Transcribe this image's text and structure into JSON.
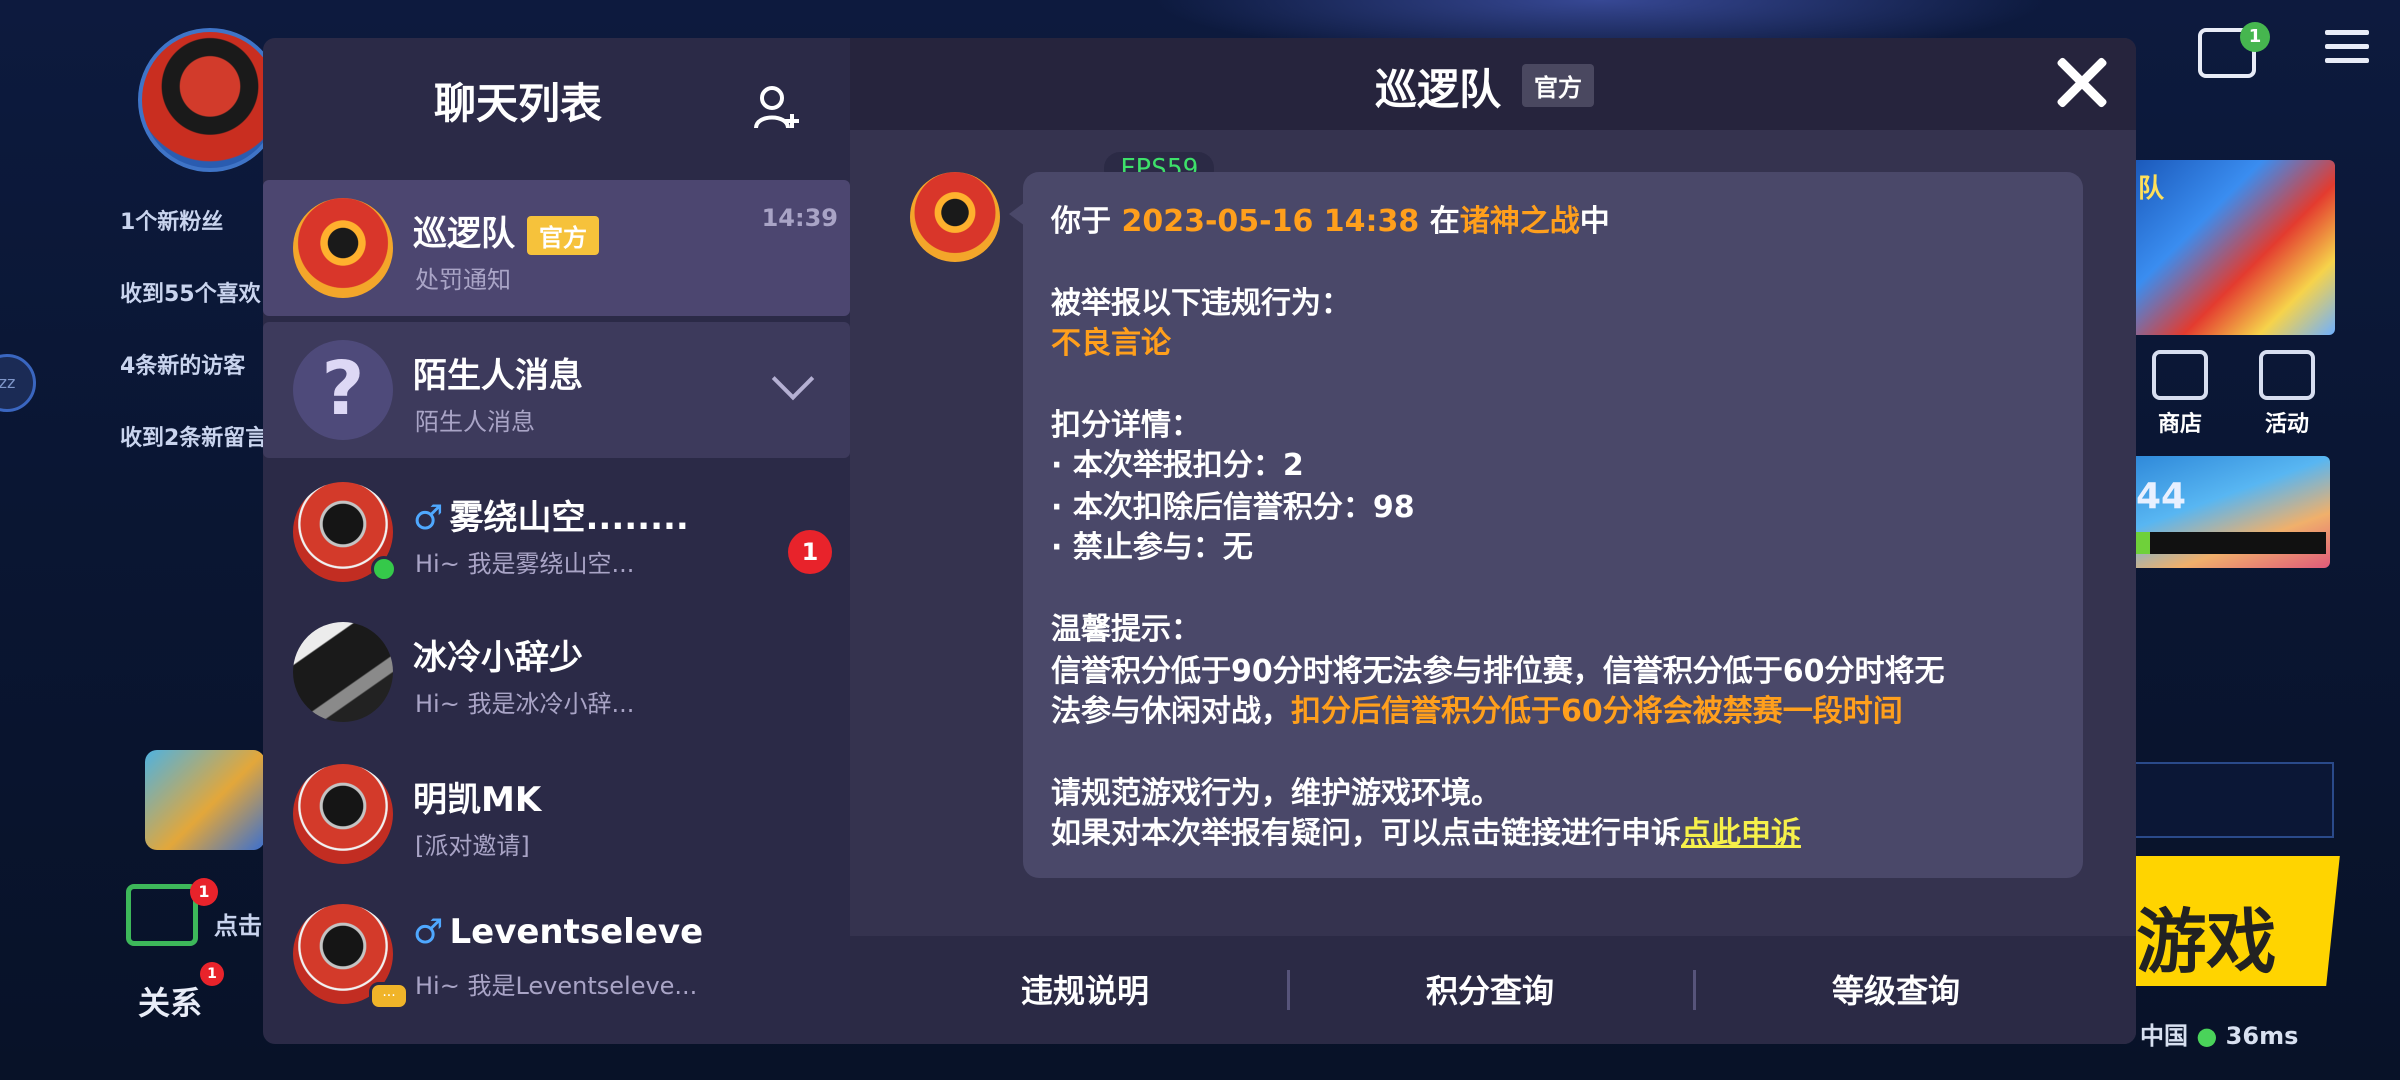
{
  "background": {
    "notifications": [
      "1个新粉丝",
      "收到55个喜欢",
      "4条新的访客",
      "收到2条新留言"
    ],
    "side_label": "zz",
    "tv_badge": "1",
    "tile_number": "44",
    "shop_label": "商店",
    "activity_label": "活动",
    "play_label": "游戏",
    "region": "中国",
    "ping": "36ms",
    "relation_label": "关系",
    "relation_badge": "1",
    "chat_badge": "1",
    "tap_hint": "点击"
  },
  "sidebar": {
    "title": "聊天列表",
    "items": [
      {
        "name": "巡逻队",
        "tag": "官方",
        "subtitle": "处罚通知",
        "time": "14:39"
      },
      {
        "name": "陌生人消息",
        "subtitle": "陌生人消息",
        "avatar_glyph": "?"
      },
      {
        "gender": "♂",
        "name": "雾绕山空........",
        "subtitle": "Hi~ 我是雾绕山空...",
        "unread": "1"
      },
      {
        "name": "冰冷小辞少",
        "subtitle": "Hi~ 我是冰冷小辞..."
      },
      {
        "name": "明凯MK",
        "subtitle": "[派对邀请]"
      },
      {
        "gender": "♂",
        "name": "Leventseleve",
        "subtitle": "Hi~ 我是Leventseleve...",
        "typing": "..."
      }
    ]
  },
  "chat": {
    "title": "巡逻队",
    "tag": "官方",
    "fps": "FPS59",
    "message": {
      "l1_a": "你于 ",
      "l1_date": "2023-05-16 14:38",
      "l1_b": " 在",
      "l1_mode": "诸神之战",
      "l1_c": "中",
      "l2": "被举报以下违规行为：",
      "l3": "不良言论",
      "l4": "扣分详情：",
      "l5": "· 本次举报扣分：2",
      "l6": "· 本次扣除后信誉积分：98",
      "l7": "· 禁止参与：无",
      "l8": "温馨提示：",
      "l9": "信誉积分低于90分时将无法参与排位赛，信誉积分低于60分时将无",
      "l10_a": "法参与休闲对战，",
      "l10_b": "扣分后信誉积分低于60分将会被禁赛一段时间",
      "l11": "请规范游戏行为，维护游戏环境。",
      "l12_a": "如果对本次举报有疑问，可以点击链接进行申诉",
      "l12_link": "点此申诉"
    },
    "footer": [
      "违规说明",
      "积分查询",
      "等级查询"
    ]
  },
  "colors": {
    "accent_orange": "#ff9f1c",
    "link_yellow": "#f6f04a",
    "official_tag": "#f6c23b",
    "fps_green": "#3ee06a"
  }
}
